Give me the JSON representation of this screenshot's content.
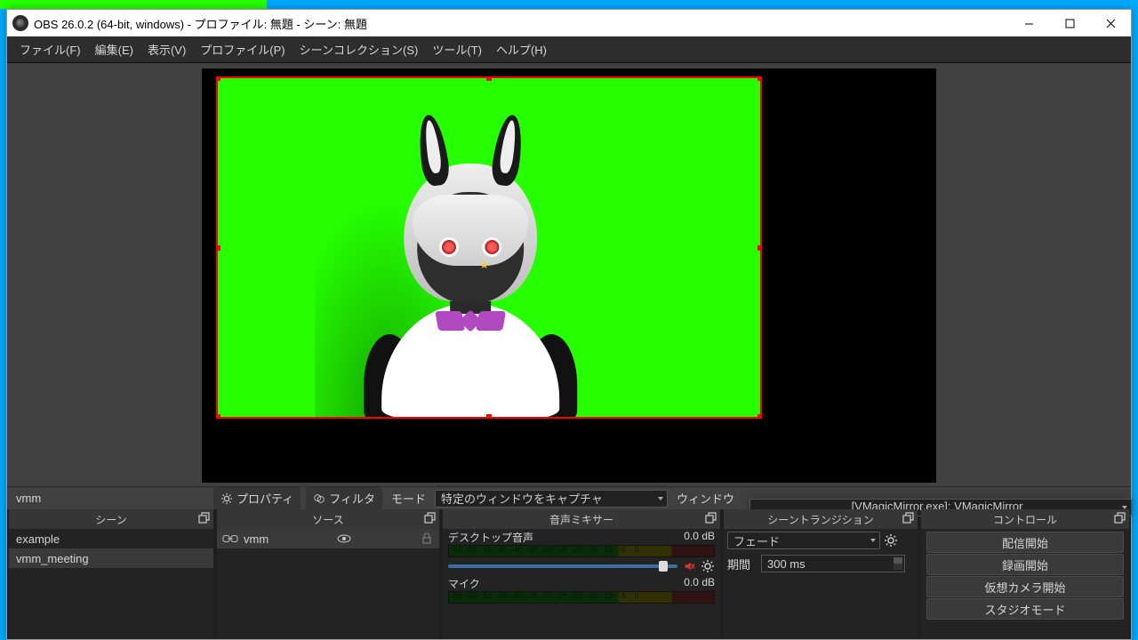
{
  "title": "OBS 26.0.2 (64-bit, windows) - プロファイル: 無題 - シーン: 無題",
  "menu": {
    "file": "ファイル(F)",
    "edit": "編集(E)",
    "view": "表示(V)",
    "profile": "プロファイル(P)",
    "scenes": "シーンコレクション(S)",
    "tools": "ツール(T)",
    "help": "ヘルプ(H)"
  },
  "selected_source": "vmm",
  "propsbar": {
    "properties": "プロパティ",
    "filter": "フィルタ",
    "mode_label": "モード",
    "mode_value": "特定のウィンドウをキャプチャ",
    "window_label": "ウィンドウ",
    "window_value": "[VMagicMirror.exe]: VMagicMirror"
  },
  "docks": {
    "scenes_title": "シーン",
    "sources_title": "ソース",
    "mixer_title": "音声ミキサー",
    "trans_title": "シーントランジション",
    "controls_title": "コントロール"
  },
  "scenes": [
    {
      "name": "example",
      "selected": false
    },
    {
      "name": "vmm_meeting",
      "selected": true
    }
  ],
  "sources": [
    {
      "name": "vmm",
      "selected": true
    }
  ],
  "mixer": {
    "ch1_name": "デスクトップ音声",
    "ch1_db": "0.0 dB",
    "ch2_name": "マイク",
    "ch2_db": "0.0 dB"
  },
  "transitions": {
    "current": "フェード",
    "duration_label": "期間",
    "duration_value": "300 ms"
  },
  "controls": {
    "stream": "配信開始",
    "record": "録画開始",
    "virtualcam": "仮想カメラ開始",
    "studio": "スタジオモード"
  },
  "colors": {
    "greenscreen": "#25ff00",
    "selection": "#ff0000"
  }
}
